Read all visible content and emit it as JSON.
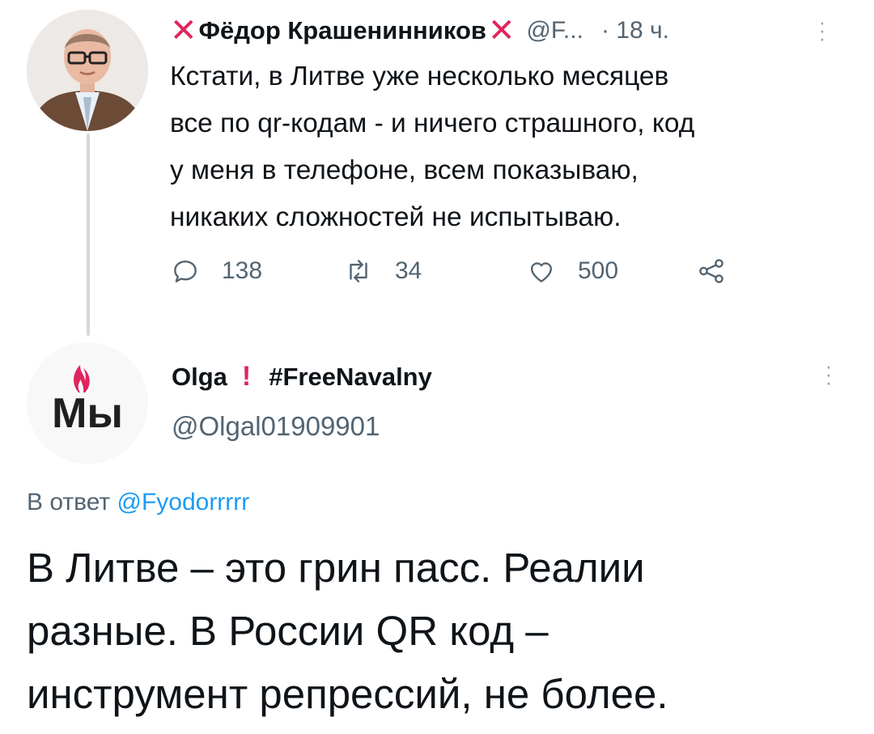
{
  "tweet": {
    "author_name": "Фёдор Крашенинников",
    "handle": "@F...",
    "separator": "·",
    "time": "18 ч.",
    "body_lines": [
      "Кстати, в Литве уже несколько месяцев",
      "все по qr-кодам - и ничего страшного, код",
      "у меня в телефоне, всем показываю,",
      "никаких сложностей не испытываю."
    ],
    "actions": {
      "replies": "138",
      "retweets": "34",
      "likes": "500"
    }
  },
  "reply": {
    "author_name": "Olga",
    "exclamation": "!",
    "hashtag": "#FreeNavalny",
    "handle": "@Olgal01909901",
    "avatar_text": "Мы",
    "in_reply_prefix": "В ответ",
    "in_reply_handle": "@Fyodorrrrr",
    "body_lines": [
      "В Литве – это грин пасс. Реалии",
      "разные. В России QR код –",
      "инструмент репрессий, не более."
    ]
  },
  "colors": {
    "accent_red": "#e0245e",
    "link_blue": "#1d9bf0",
    "secondary_text": "#536471",
    "thread_line": "#cfd9de"
  },
  "icons": [
    "x-mark-icon",
    "more-options-icon",
    "reply-icon",
    "retweet-icon",
    "like-icon",
    "share-icon",
    "flame-icon"
  ]
}
